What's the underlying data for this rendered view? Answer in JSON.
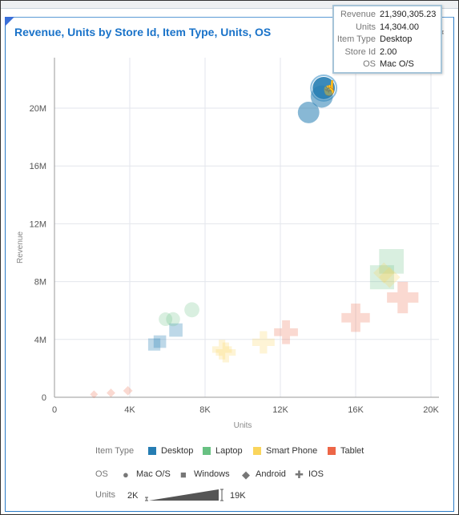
{
  "chart_data": {
    "type": "scatter",
    "title": "Revenue, Units by Store Id, Item Type, Units, OS",
    "xlabel": "Units",
    "ylabel": "Revenue",
    "xlim": [
      0,
      20000
    ],
    "ylim": [
      0,
      24000000
    ],
    "x_ticks": [
      "0",
      "4K",
      "8K",
      "12K",
      "16K",
      "20K"
    ],
    "x_tick_values": [
      0,
      4000,
      8000,
      12000,
      16000,
      20000
    ],
    "y_ticks": [
      "0",
      "4M",
      "8M",
      "12M",
      "16M",
      "20M"
    ],
    "y_tick_values": [
      0,
      4000000,
      8000000,
      12000000,
      16000000,
      20000000
    ],
    "grid": true,
    "colors": {
      "Desktop": "#267db3",
      "Laptop": "#68c182",
      "Smart Phone": "#fad55c",
      "Tablet": "#ed6647"
    },
    "shapes": {
      "Mac O/S": "circle",
      "Windows": "square",
      "Android": "diamond",
      "IOS": "cross"
    },
    "size_range": [
      2000,
      19000
    ],
    "points": [
      {
        "item": "Desktop",
        "os": "Mac O/S",
        "units": 14304,
        "revenue": 21390305.23,
        "highlighted": true
      },
      {
        "item": "Desktop",
        "os": "Mac O/S",
        "units": 14200,
        "revenue": 20800000
      },
      {
        "item": "Desktop",
        "os": "Mac O/S",
        "units": 13500,
        "revenue": 19700000
      },
      {
        "item": "Desktop",
        "os": "Windows",
        "units": 5300,
        "revenue": 3650000
      },
      {
        "item": "Desktop",
        "os": "Windows",
        "units": 5600,
        "revenue": 3850000
      },
      {
        "item": "Desktop",
        "os": "Windows",
        "units": 6450,
        "revenue": 4650000
      },
      {
        "item": "Laptop",
        "os": "Mac O/S",
        "units": 5900,
        "revenue": 5400000
      },
      {
        "item": "Laptop",
        "os": "Mac O/S",
        "units": 6300,
        "revenue": 5400000
      },
      {
        "item": "Laptop",
        "os": "Mac O/S",
        "units": 7300,
        "revenue": 6050000
      },
      {
        "item": "Laptop",
        "os": "Windows",
        "units": 17900,
        "revenue": 9400000
      },
      {
        "item": "Laptop",
        "os": "Windows",
        "units": 17400,
        "revenue": 8300000
      },
      {
        "item": "Smart Phone",
        "os": "Android",
        "units": 17500,
        "revenue": 8600000
      },
      {
        "item": "Smart Phone",
        "os": "Android",
        "units": 17800,
        "revenue": 8300000
      },
      {
        "item": "Smart Phone",
        "os": "IOS",
        "units": 8900,
        "revenue": 3300000
      },
      {
        "item": "Smart Phone",
        "os": "IOS",
        "units": 9100,
        "revenue": 3100000
      },
      {
        "item": "Smart Phone",
        "os": "IOS",
        "units": 11100,
        "revenue": 3800000
      },
      {
        "item": "Tablet",
        "os": "IOS",
        "units": 12300,
        "revenue": 4500000
      },
      {
        "item": "Tablet",
        "os": "IOS",
        "units": 16000,
        "revenue": 5500000
      },
      {
        "item": "Tablet",
        "os": "IOS",
        "units": 18500,
        "revenue": 6900000
      },
      {
        "item": "Tablet",
        "os": "Android",
        "units": 2100,
        "revenue": 200000
      },
      {
        "item": "Tablet",
        "os": "Android",
        "units": 3000,
        "revenue": 300000
      },
      {
        "item": "Tablet",
        "os": "Android",
        "units": 3900,
        "revenue": 450000
      }
    ]
  },
  "tooltip": [
    {
      "key": "Revenue",
      "value": "21,390,305.23"
    },
    {
      "key": "Units",
      "value": "14,304.00"
    },
    {
      "key": "Item Type",
      "value": "Desktop"
    },
    {
      "key": "Store Id",
      "value": "2.00"
    },
    {
      "key": "OS",
      "value": "Mac O/S"
    }
  ],
  "legend": {
    "item_type_title": "Item Type",
    "item_types": [
      "Desktop",
      "Laptop",
      "Smart Phone",
      "Tablet"
    ],
    "os_title": "OS",
    "os": [
      "Mac O/S",
      "Windows",
      "Android",
      "IOS"
    ],
    "units_title": "Units",
    "units_min": "2K",
    "units_max": "19K"
  },
  "icons": {
    "settings": "gear-icon",
    "cursor": "hand-pointer-icon"
  }
}
